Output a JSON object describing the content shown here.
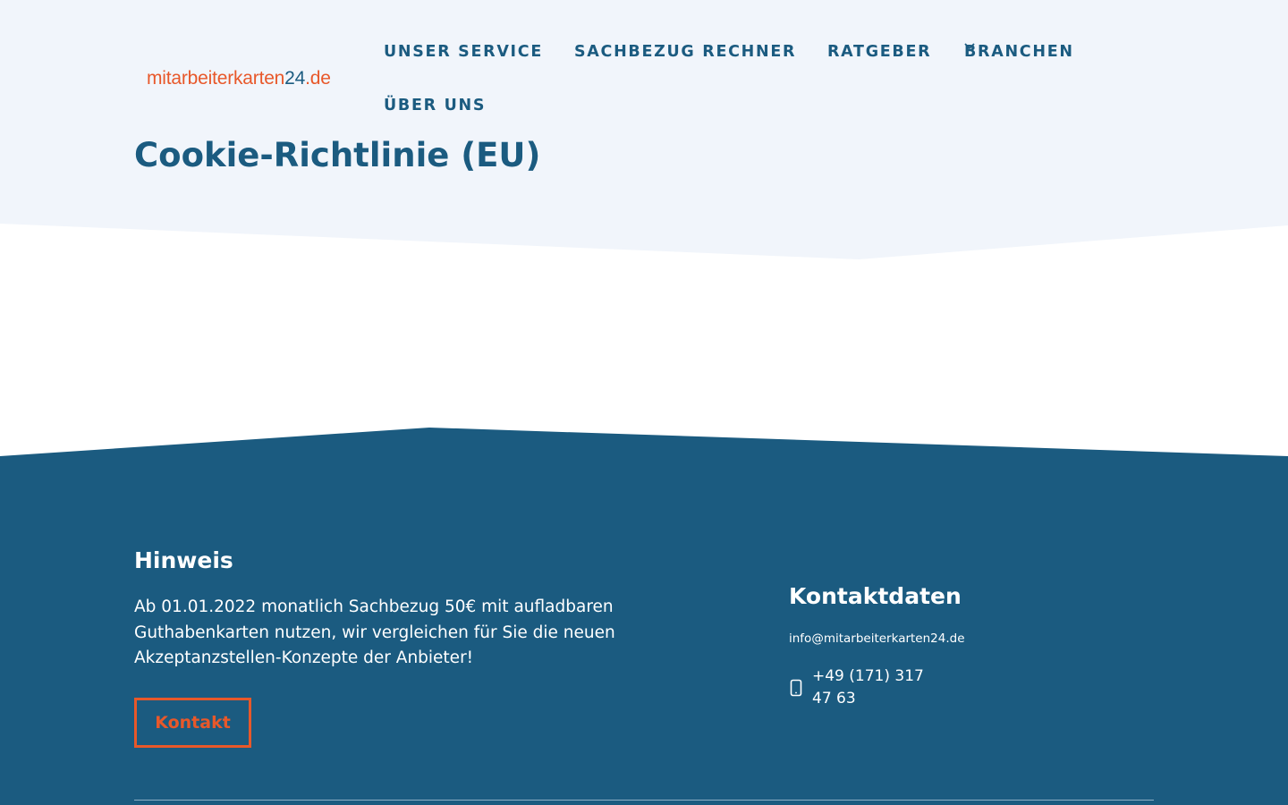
{
  "header": {
    "logo_main": "mitarbeiterkarten",
    "logo_num": "24",
    "logo_tld": ".de",
    "nav": [
      {
        "label": "UNSER SERVICE"
      },
      {
        "label": "SACHBEZUG RECHNER"
      },
      {
        "label": "RATGEBER"
      },
      {
        "label": "BRANCHEN",
        "icon": "chevron-down-icon"
      },
      {
        "label": "ÜBER UNS"
      }
    ]
  },
  "page": {
    "title": "Cookie-Richtlinie (EU)"
  },
  "footer": {
    "hinweis": {
      "title": "Hinweis",
      "text": "Ab 01.01.2022 monatlich Sachbezug 50€ mit aufladbaren Guthabenkarten nutzen, wir vergleichen für Sie die neuen Akzeptanzstellen-Konzepte der Anbieter!",
      "button_label": "Kontakt"
    },
    "kontakt": {
      "title": "Kontaktdaten",
      "email": "info@mitarbeiterkarten24.de",
      "phone": "+49 (171) 317 47 63",
      "phone_icon": "mobile-phone-icon"
    }
  },
  "colors": {
    "brand_blue": "#1b5b80",
    "accent_orange": "#e8582a",
    "hero_bg": "#f1f5fb",
    "footer_bg": "#1b5b80"
  }
}
